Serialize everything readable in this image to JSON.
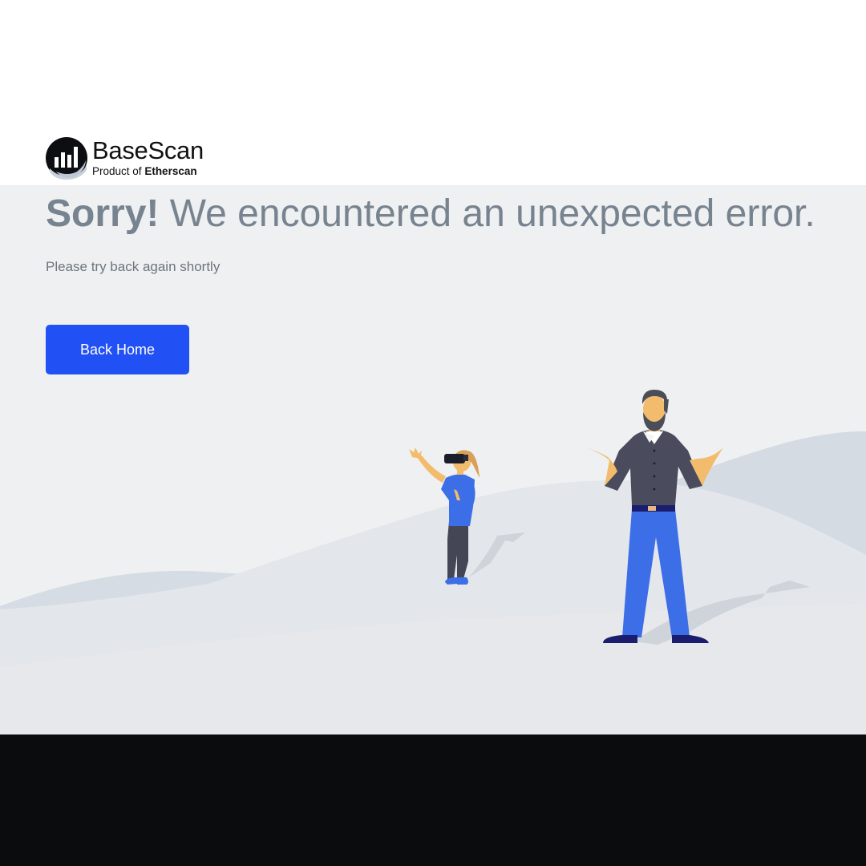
{
  "brand": {
    "name": "BaseScan",
    "sub_prefix": "Product of",
    "sub_strong": "Etherscan",
    "logo_icon": "basescan-logo-icon"
  },
  "error": {
    "title_strong": "Sorry!",
    "title_rest": " We encountered an unexpected error.",
    "message": "Please try back again shortly"
  },
  "actions": {
    "back_home_label": "Back Home"
  },
  "colors": {
    "accent": "#2150f5",
    "page_bg": "#eef0f2",
    "heading": "#77838f",
    "footer_bg": "#0b0c0e"
  },
  "illustration": {
    "name": "confused-man-and-vr-girl-illustration"
  }
}
